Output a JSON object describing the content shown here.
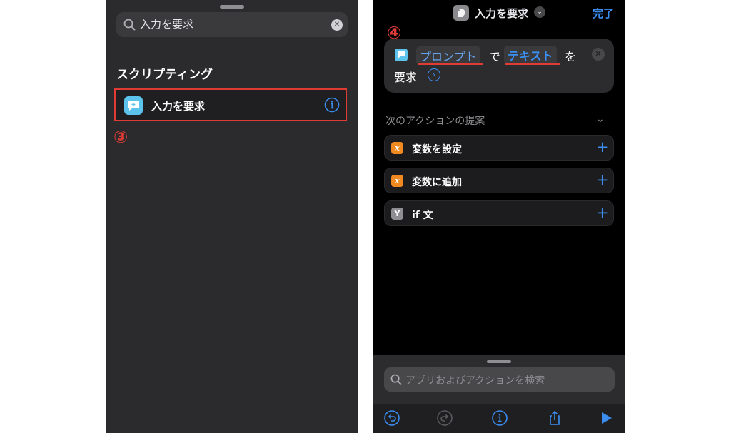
{
  "left": {
    "search_query": "入力を要求",
    "section_title": "スクリプティング",
    "result_label": "入力を要求",
    "step_marker": "③"
  },
  "right": {
    "title": "入力を要求",
    "done_label": "完了",
    "step_marker": "④",
    "action": {
      "token_prompt": "プロンプト",
      "particle_de": "で",
      "token_text": "テキスト",
      "particle_wo": "を",
      "verb": "要求"
    },
    "suggestions_header": "次のアクションの提案",
    "suggestions": [
      {
        "label": "変数を設定",
        "badge": "x",
        "color": "#f0891f"
      },
      {
        "label": "変数に追加",
        "badge": "x",
        "color": "#f0891f"
      },
      {
        "label": "if 文",
        "badge": "Y",
        "color": "#8e8e93"
      }
    ],
    "search_placeholder": "アプリおよびアクションを検索"
  },
  "colors": {
    "accent": "#3b8ef0",
    "annotation_red": "#e03b35"
  }
}
